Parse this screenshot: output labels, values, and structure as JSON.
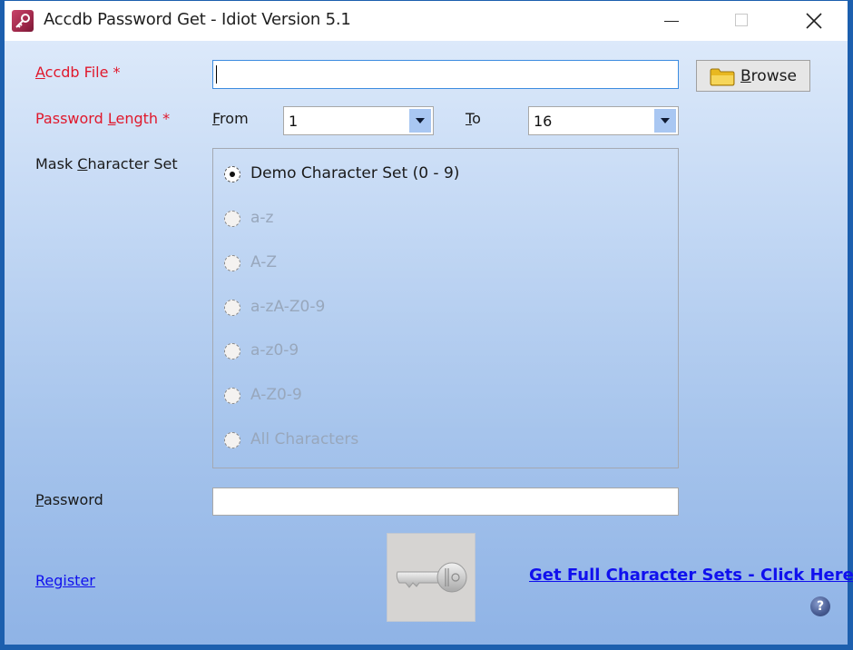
{
  "window": {
    "title": "Accdb Password Get - Idiot Version 5.1",
    "app_icon": "access-key-icon",
    "controls": {
      "minimize": "minimize-icon",
      "maximize": "maximize-icon",
      "close": "close-icon"
    }
  },
  "form": {
    "accdb_file": {
      "label_mnemonic": "A",
      "label_rest": "ccdb File *",
      "value": ""
    },
    "browse": {
      "icon": "folder-icon",
      "label_mnemonic": "B",
      "label_rest": "rowse"
    },
    "password_length": {
      "label_before": "Password ",
      "label_mnemonic": "L",
      "label_rest": "ength *",
      "from": {
        "label_mnemonic": "F",
        "label_rest": "rom",
        "value": "1"
      },
      "to": {
        "label_mnemonic": "T",
        "label_rest": "o",
        "value": "16"
      }
    },
    "mask": {
      "label_before": "Mask ",
      "label_mnemonic": "C",
      "label_rest": "haracter Set",
      "options": [
        {
          "label": "Demo Character Set (0 - 9)",
          "selected": true,
          "enabled": true
        },
        {
          "label": "a-z",
          "selected": false,
          "enabled": false
        },
        {
          "label": "A-Z",
          "selected": false,
          "enabled": false
        },
        {
          "label": "a-zA-Z0-9",
          "selected": false,
          "enabled": false
        },
        {
          "label": "a-z0-9",
          "selected": false,
          "enabled": false
        },
        {
          "label": "A-Z0-9",
          "selected": false,
          "enabled": false
        },
        {
          "label": "All Characters",
          "selected": false,
          "enabled": false
        }
      ]
    },
    "password": {
      "label_mnemonic": "P",
      "label_rest": "assword",
      "value": ""
    }
  },
  "footer": {
    "register_link": "Register",
    "full_sets_link": "Get Full Character Sets - Click Here",
    "start_button_icon": "key-icon",
    "help_icon_glyph": "?"
  },
  "colors": {
    "required_label": "#e0182c",
    "link": "#1010ee",
    "window_border": "#1c5fae"
  }
}
